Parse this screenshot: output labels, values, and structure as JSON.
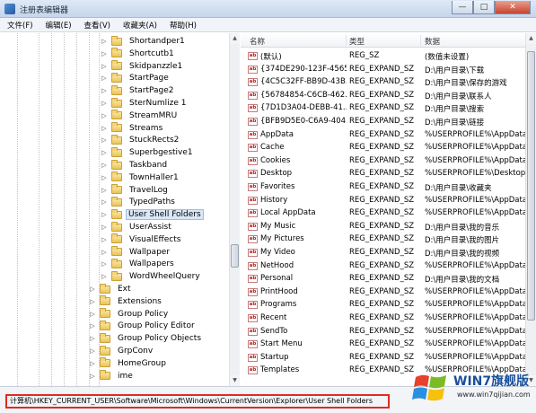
{
  "window": {
    "title": "注册表编辑器",
    "minimize": "—",
    "maximize": "□",
    "close": "✕"
  },
  "menu": [
    "文件(F)",
    "编辑(E)",
    "查看(V)",
    "收藏夹(A)",
    "帮助(H)"
  ],
  "tree": [
    {
      "label": "Shortandper1",
      "level": 2,
      "expanded": false,
      "selected": false
    },
    {
      "label": "Shortcutb1",
      "level": 2,
      "expanded": false,
      "selected": false
    },
    {
      "label": "Skidpanzzle1",
      "level": 2,
      "expanded": false,
      "selected": false
    },
    {
      "label": "StartPage",
      "level": 2,
      "expanded": false,
      "selected": false
    },
    {
      "label": "StartPage2",
      "level": 2,
      "expanded": false,
      "selected": false
    },
    {
      "label": "SterNumlize 1",
      "level": 2,
      "expanded": false,
      "selected": false
    },
    {
      "label": "StreamMRU",
      "level": 2,
      "expanded": false,
      "selected": false
    },
    {
      "label": "Streams",
      "level": 2,
      "expanded": false,
      "selected": false
    },
    {
      "label": "StuckRects2",
      "level": 2,
      "expanded": false,
      "selected": false
    },
    {
      "label": "Superbgestive1",
      "level": 2,
      "expanded": false,
      "selected": false
    },
    {
      "label": "Taskband",
      "level": 2,
      "expanded": false,
      "selected": false
    },
    {
      "label": "TownHaller1",
      "level": 2,
      "expanded": false,
      "selected": false
    },
    {
      "label": "TravelLog",
      "level": 2,
      "expanded": false,
      "selected": false
    },
    {
      "label": "TypedPaths",
      "level": 2,
      "expanded": false,
      "selected": false
    },
    {
      "label": "User Shell Folders",
      "level": 2,
      "expanded": false,
      "selected": true
    },
    {
      "label": "UserAssist",
      "level": 2,
      "expanded": false,
      "selected": false
    },
    {
      "label": "VisualEffects",
      "level": 2,
      "expanded": false,
      "selected": false
    },
    {
      "label": "Wallpaper",
      "level": 2,
      "expanded": false,
      "selected": false
    },
    {
      "label": "Wallpapers",
      "level": 2,
      "expanded": false,
      "selected": false
    },
    {
      "label": "WordWheelQuery",
      "level": 2,
      "expanded": false,
      "selected": false
    },
    {
      "label": "Ext",
      "level": 1,
      "expanded": false,
      "selected": false
    },
    {
      "label": "Extensions",
      "level": 1,
      "expanded": false,
      "selected": false
    },
    {
      "label": "Group Policy",
      "level": 1,
      "expanded": false,
      "selected": false
    },
    {
      "label": "Group Policy Editor",
      "level": 1,
      "expanded": false,
      "selected": false
    },
    {
      "label": "Group Policy Objects",
      "level": 1,
      "expanded": false,
      "selected": false
    },
    {
      "label": "GrpConv",
      "level": 1,
      "expanded": false,
      "selected": false
    },
    {
      "label": "HomeGroup",
      "level": 1,
      "expanded": false,
      "selected": false
    },
    {
      "label": "ime",
      "level": 1,
      "expanded": false,
      "selected": false
    }
  ],
  "list": {
    "headers": {
      "name": "名称",
      "type": "类型",
      "data": "数据"
    },
    "rows": [
      {
        "name": "(默认)",
        "type": "REG_SZ",
        "data": "(数值未设置)"
      },
      {
        "name": "{374DE290-123F-4565...",
        "type": "REG_EXPAND_SZ",
        "data": "D:\\用户目录\\下载"
      },
      {
        "name": "{4C5C32FF-BB9D-43B...",
        "type": "REG_EXPAND_SZ",
        "data": "D:\\用户目录\\保存的游戏"
      },
      {
        "name": "{56784854-C6CB-462...",
        "type": "REG_EXPAND_SZ",
        "data": "D:\\用户目录\\联系人"
      },
      {
        "name": "{7D1D3A04-DEBB-41...",
        "type": "REG_EXPAND_SZ",
        "data": "D:\\用户目录\\搜索"
      },
      {
        "name": "{BFB9D5E0-C6A9-404...",
        "type": "REG_EXPAND_SZ",
        "data": "D:\\用户目录\\链接"
      },
      {
        "name": "AppData",
        "type": "REG_EXPAND_SZ",
        "data": "%USERPROFILE%\\AppData\\Ro"
      },
      {
        "name": "Cache",
        "type": "REG_EXPAND_SZ",
        "data": "%USERPROFILE%\\AppData\\Lo"
      },
      {
        "name": "Cookies",
        "type": "REG_EXPAND_SZ",
        "data": "%USERPROFILE%\\AppData\\Ro"
      },
      {
        "name": "Desktop",
        "type": "REG_EXPAND_SZ",
        "data": "%USERPROFILE%\\Desktop"
      },
      {
        "name": "Favorites",
        "type": "REG_EXPAND_SZ",
        "data": "D:\\用户目录\\收藏夹"
      },
      {
        "name": "History",
        "type": "REG_EXPAND_SZ",
        "data": "%USERPROFILE%\\AppData\\Lo"
      },
      {
        "name": "Local AppData",
        "type": "REG_EXPAND_SZ",
        "data": "%USERPROFILE%\\AppData\\Lo"
      },
      {
        "name": "My Music",
        "type": "REG_EXPAND_SZ",
        "data": "D:\\用户目录\\我的音乐"
      },
      {
        "name": "My Pictures",
        "type": "REG_EXPAND_SZ",
        "data": "D:\\用户目录\\我的图片"
      },
      {
        "name": "My Video",
        "type": "REG_EXPAND_SZ",
        "data": "D:\\用户目录\\我的视频"
      },
      {
        "name": "NetHood",
        "type": "REG_EXPAND_SZ",
        "data": "%USERPROFILE%\\AppData\\Ro"
      },
      {
        "name": "Personal",
        "type": "REG_EXPAND_SZ",
        "data": "D:\\用户目录\\我的文档"
      },
      {
        "name": "PrintHood",
        "type": "REG_EXPAND_SZ",
        "data": "%USERPROFILE%\\AppData\\Ro"
      },
      {
        "name": "Programs",
        "type": "REG_EXPAND_SZ",
        "data": "%USERPROFILE%\\AppData\\Ro"
      },
      {
        "name": "Recent",
        "type": "REG_EXPAND_SZ",
        "data": "%USERPROFILE%\\AppData\\Ro"
      },
      {
        "name": "SendTo",
        "type": "REG_EXPAND_SZ",
        "data": "%USERPROFILE%\\AppData\\Ro"
      },
      {
        "name": "Start Menu",
        "type": "REG_EXPAND_SZ",
        "data": "%USERPROFILE%\\AppData\\Ro"
      },
      {
        "name": "Startup",
        "type": "REG_EXPAND_SZ",
        "data": "%USERPROFILE%\\AppData\\Ro"
      },
      {
        "name": "Templates",
        "type": "REG_EXPAND_SZ",
        "data": "%USERPROFILE%\\AppData\\Ro"
      }
    ]
  },
  "status": {
    "path": "计算机\\HKEY_CURRENT_USER\\Software\\Microsoft\\Windows\\CurrentVersion\\Explorer\\User Shell Folders"
  },
  "watermark": {
    "title": "WIN7旗舰版",
    "url": "www.win7qijian.com"
  },
  "colors": {
    "highlight_border": "#e02b20",
    "selection": "#d9e7f8",
    "folder": "#e9c458"
  },
  "icons": {
    "tree_folder": "folder-icon",
    "value": "string-value-icon",
    "watermark_logo": "windows-logo-icon"
  }
}
